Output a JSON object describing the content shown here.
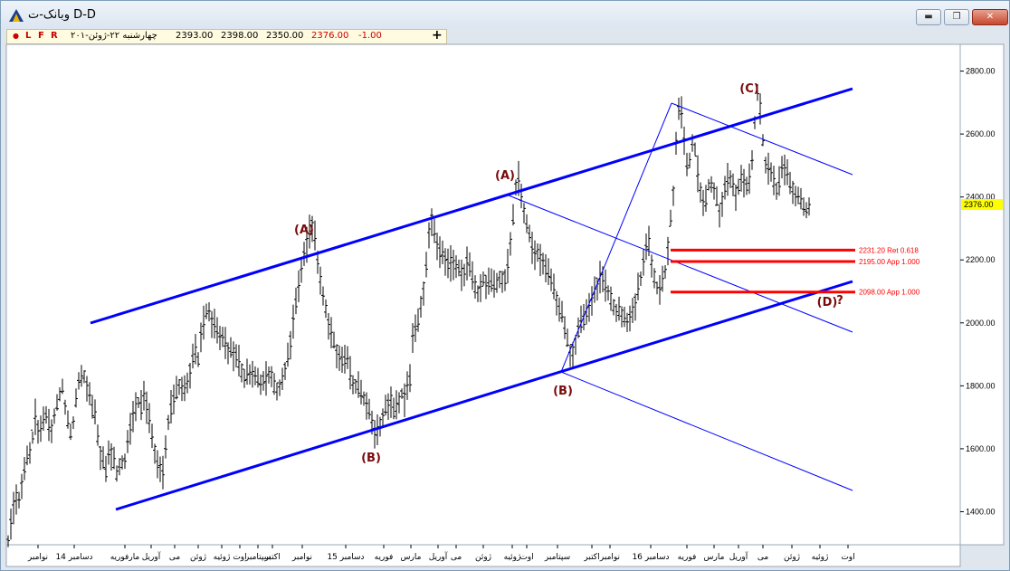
{
  "window": {
    "title": "وبانک-ت D-D",
    "minimize_label": "▬",
    "restore_label": "❐",
    "close_label": "✕"
  },
  "toolbar": {
    "dot": "●",
    "btn_l": "L",
    "btn_f": "F",
    "btn_r": "R",
    "plus": "+"
  },
  "quote": {
    "date": "چهارشنبه ۲۲-ژوئن-۲۰۱",
    "open": "2393.00",
    "high": "2398.00",
    "low": "2350.00",
    "close": "2376.00",
    "change": "-1.00"
  },
  "colors": {
    "trend": "#0000ff",
    "level": "#ff0000",
    "wave_label": "#7a0a0a",
    "price_badge": "#ffff00"
  },
  "chart_data": {
    "type": "candlestick",
    "y_axis": {
      "range": [
        1295,
        2885
      ],
      "ticks": [
        "1400.00",
        "1600.00",
        "1800.00",
        "2000.00",
        "2200.00",
        "2400.00",
        "2600.00",
        "2800.00"
      ],
      "position": "right"
    },
    "x_axis": {
      "tick_labels": [
        "نوامبر",
        "14 دسامبر",
        "مارفوریه",
        "آوریل",
        "می",
        "ژوئن",
        "ژوئیه",
        "اوت",
        "سپتامبر",
        "اکتبر",
        "نوامبر",
        "15 دسامبر",
        "فوریه",
        "مارس",
        "آوریل",
        "می",
        "ژوئن",
        "ژوئیه",
        "اوت",
        "سپتامبر",
        "اکتبر",
        "نوامبر",
        "16 دسامبر",
        "فوریه",
        "مارس",
        "آوریل",
        "می",
        "ژوئن",
        "ژوئیه",
        "اوت"
      ]
    },
    "last_price": "2376.00",
    "wave_labels": [
      "(A)",
      "(B)",
      "(A)",
      "(B)",
      "(C)",
      "(D)",
      "?"
    ],
    "levels": [
      {
        "label": "2231.20 Ret 0.618",
        "value": 2231.2
      },
      {
        "label": "2195.00 App 1.000",
        "value": 2195
      },
      {
        "label": "2098.00 App 1.000",
        "value": 2098
      }
    ],
    "price_path": [
      [
        0,
        1310
      ],
      [
        4,
        1390
      ],
      [
        8,
        1450
      ],
      [
        12,
        1440
      ],
      [
        20,
        1560
      ],
      [
        26,
        1620
      ],
      [
        30,
        1700
      ],
      [
        35,
        1630
      ],
      [
        38,
        1680
      ],
      [
        42,
        1700
      ],
      [
        47,
        1660
      ],
      [
        52,
        1720
      ],
      [
        56,
        1760
      ],
      [
        60,
        1800
      ],
      [
        64,
        1720
      ],
      [
        68,
        1640
      ],
      [
        72,
        1680
      ],
      [
        78,
        1820
      ],
      [
        83,
        1840
      ],
      [
        88,
        1790
      ],
      [
        92,
        1730
      ],
      [
        96,
        1700
      ],
      [
        100,
        1620
      ],
      [
        104,
        1560
      ],
      [
        108,
        1530
      ],
      [
        112,
        1600
      ],
      [
        116,
        1560
      ],
      [
        120,
        1520
      ],
      [
        124,
        1560
      ],
      [
        128,
        1540
      ],
      [
        132,
        1610
      ],
      [
        136,
        1680
      ],
      [
        140,
        1720
      ],
      [
        143,
        1750
      ],
      [
        147,
        1730
      ],
      [
        151,
        1770
      ],
      [
        155,
        1700
      ],
      [
        159,
        1650
      ],
      [
        163,
        1580
      ],
      [
        167,
        1540
      ],
      [
        171,
        1530
      ],
      [
        175,
        1630
      ],
      [
        179,
        1720
      ],
      [
        184,
        1760
      ],
      [
        189,
        1800
      ],
      [
        194,
        1780
      ],
      [
        199,
        1830
      ],
      [
        203,
        1870
      ],
      [
        207,
        1910
      ],
      [
        210,
        1880
      ],
      [
        213,
        1950
      ],
      [
        217,
        2010
      ],
      [
        221,
        2050
      ],
      [
        225,
        2000
      ],
      [
        229,
        1990
      ],
      [
        234,
        1960
      ],
      [
        239,
        1950
      ],
      [
        244,
        1910
      ],
      [
        249,
        1900
      ],
      [
        254,
        1880
      ],
      [
        259,
        1840
      ],
      [
        264,
        1830
      ],
      [
        269,
        1850
      ],
      [
        274,
        1830
      ],
      [
        279,
        1810
      ],
      [
        284,
        1820
      ],
      [
        289,
        1840
      ],
      [
        294,
        1800
      ],
      [
        299,
        1790
      ],
      [
        304,
        1830
      ],
      [
        309,
        1880
      ],
      [
        313,
        1960
      ],
      [
        317,
        2040
      ],
      [
        321,
        2110
      ],
      [
        324,
        2160
      ],
      [
        327,
        2210
      ],
      [
        330,
        2250
      ],
      [
        333,
        2290
      ],
      [
        336,
        2310
      ],
      [
        339,
        2270
      ],
      [
        342,
        2200
      ],
      [
        345,
        2140
      ],
      [
        348,
        2090
      ],
      [
        351,
        2040
      ],
      [
        354,
        2000
      ],
      [
        358,
        1960
      ],
      [
        362,
        1920
      ],
      [
        366,
        1890
      ],
      [
        370,
        1870
      ],
      [
        374,
        1880
      ],
      [
        378,
        1840
      ],
      [
        382,
        1810
      ],
      [
        386,
        1790
      ],
      [
        390,
        1780
      ],
      [
        394,
        1750
      ],
      [
        398,
        1720
      ],
      [
        402,
        1680
      ],
      [
        406,
        1640
      ],
      [
        410,
        1670
      ],
      [
        414,
        1700
      ],
      [
        418,
        1730
      ],
      [
        422,
        1760
      ],
      [
        426,
        1720
      ],
      [
        430,
        1740
      ],
      [
        434,
        1780
      ],
      [
        438,
        1760
      ],
      [
        442,
        1800
      ],
      [
        445,
        1830
      ],
      [
        447,
        1950
      ],
      [
        450,
        1980
      ],
      [
        453,
        2000
      ],
      [
        456,
        2060
      ],
      [
        459,
        2110
      ],
      [
        462,
        2190
      ],
      [
        465,
        2290
      ],
      [
        468,
        2330
      ],
      [
        471,
        2280
      ],
      [
        475,
        2240
      ],
      [
        479,
        2220
      ],
      [
        483,
        2200
      ],
      [
        487,
        2180
      ],
      [
        491,
        2200
      ],
      [
        495,
        2180
      ],
      [
        499,
        2170
      ],
      [
        503,
        2150
      ],
      [
        507,
        2190
      ],
      [
        511,
        2160
      ],
      [
        515,
        2120
      ],
      [
        519,
        2100
      ],
      [
        523,
        2130
      ],
      [
        527,
        2140
      ],
      [
        531,
        2120
      ],
      [
        535,
        2130
      ],
      [
        539,
        2120
      ],
      [
        543,
        2150
      ],
      [
        547,
        2130
      ],
      [
        551,
        2160
      ],
      [
        554,
        2220
      ],
      [
        557,
        2300
      ],
      [
        560,
        2400
      ],
      [
        563,
        2480
      ],
      [
        566,
        2420
      ],
      [
        569,
        2380
      ],
      [
        572,
        2330
      ],
      [
        575,
        2290
      ],
      [
        578,
        2250
      ],
      [
        581,
        2230
      ],
      [
        585,
        2220
      ],
      [
        589,
        2200
      ],
      [
        593,
        2170
      ],
      [
        597,
        2150
      ],
      [
        601,
        2120
      ],
      [
        605,
        2080
      ],
      [
        609,
        2040
      ],
      [
        613,
        2010
      ],
      [
        617,
        1960
      ],
      [
        620,
        1920
      ],
      [
        623,
        1900
      ],
      [
        626,
        1930
      ],
      [
        629,
        1960
      ],
      [
        632,
        1990
      ],
      [
        636,
        2010
      ],
      [
        640,
        2030
      ],
      [
        644,
        2060
      ],
      [
        648,
        2110
      ],
      [
        652,
        2130
      ],
      [
        656,
        2150
      ],
      [
        660,
        2120
      ],
      [
        664,
        2090
      ],
      [
        668,
        2060
      ],
      [
        672,
        2040
      ],
      [
        676,
        2030
      ],
      [
        680,
        2020
      ],
      [
        684,
        2010
      ],
      [
        688,
        2030
      ],
      [
        692,
        2050
      ],
      [
        696,
        2100
      ],
      [
        700,
        2150
      ],
      [
        704,
        2220
      ],
      [
        708,
        2250
      ],
      [
        712,
        2180
      ],
      [
        716,
        2120
      ],
      [
        720,
        2100
      ],
      [
        724,
        2140
      ],
      [
        727,
        2180
      ],
      [
        730,
        2270
      ],
      [
        733,
        2350
      ],
      [
        736,
        2450
      ],
      [
        739,
        2620
      ],
      [
        742,
        2700
      ],
      [
        745,
        2650
      ],
      [
        748,
        2560
      ],
      [
        751,
        2480
      ],
      [
        754,
        2530
      ],
      [
        757,
        2600
      ],
      [
        760,
        2520
      ],
      [
        763,
        2450
      ],
      [
        766,
        2400
      ],
      [
        769,
        2370
      ],
      [
        772,
        2400
      ],
      [
        775,
        2460
      ],
      [
        778,
        2440
      ],
      [
        781,
        2420
      ],
      [
        784,
        2380
      ],
      [
        787,
        2350
      ],
      [
        790,
        2400
      ],
      [
        793,
        2450
      ],
      [
        796,
        2470
      ],
      [
        799,
        2460
      ],
      [
        802,
        2430
      ],
      [
        805,
        2400
      ],
      [
        808,
        2440
      ],
      [
        811,
        2470
      ],
      [
        814,
        2450
      ],
      [
        817,
        2430
      ],
      [
        820,
        2480
      ],
      [
        823,
        2560
      ],
      [
        826,
        2680
      ],
      [
        829,
        2750
      ],
      [
        832,
        2650
      ],
      [
        835,
        2550
      ],
      [
        838,
        2490
      ],
      [
        841,
        2500
      ],
      [
        844,
        2470
      ],
      [
        847,
        2440
      ],
      [
        850,
        2420
      ],
      [
        853,
        2460
      ],
      [
        856,
        2510
      ],
      [
        859,
        2490
      ],
      [
        862,
        2470
      ],
      [
        865,
        2440
      ],
      [
        868,
        2430
      ],
      [
        871,
        2410
      ],
      [
        874,
        2400
      ],
      [
        877,
        2390
      ],
      [
        880,
        2370
      ],
      [
        883,
        2360
      ],
      [
        886,
        2376
      ]
    ]
  }
}
